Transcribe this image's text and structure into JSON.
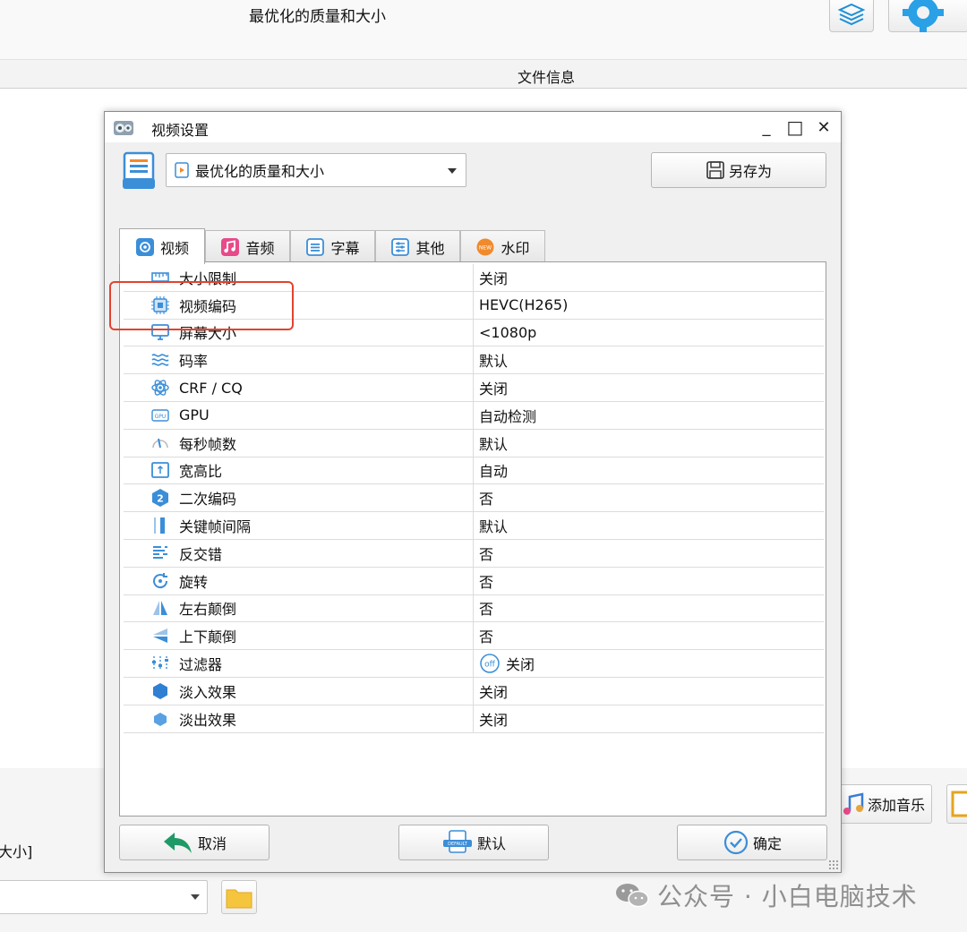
{
  "background": {
    "profile_title": "最优化的质量和大小",
    "file_info_title": "文件信息",
    "add_music_label": "添加音乐",
    "left_label": "大小]",
    "watermark": "公众号 · 小白电脑技术"
  },
  "dialog": {
    "title": "视频设置",
    "minimize": "_",
    "maximize": "□",
    "close": "✕",
    "profile_value": "最优化的质量和大小",
    "save_as_label": "另存为",
    "tabs": [
      {
        "label": "视频",
        "icon": "video-tab-icon"
      },
      {
        "label": "音频",
        "icon": "audio-tab-icon"
      },
      {
        "label": "字幕",
        "icon": "subtitle-tab-icon"
      },
      {
        "label": "其他",
        "icon": "other-tab-icon"
      },
      {
        "label": "水印",
        "icon": "watermark-tab-icon"
      }
    ],
    "settings": [
      {
        "name": "大小限制",
        "value": "关闭"
      },
      {
        "name": "视频编码",
        "value": "HEVC(H265)"
      },
      {
        "name": "屏幕大小",
        "value": "<1080p"
      },
      {
        "name": "码率",
        "value": "默认"
      },
      {
        "name": "CRF / CQ",
        "value": "关闭"
      },
      {
        "name": "GPU",
        "value": "自动检测"
      },
      {
        "name": "每秒帧数",
        "value": "默认"
      },
      {
        "name": "宽高比",
        "value": "自动"
      },
      {
        "name": "二次编码",
        "value": "否"
      },
      {
        "name": "关键帧间隔",
        "value": "默认"
      },
      {
        "name": "反交错",
        "value": "否"
      },
      {
        "name": "旋转",
        "value": "否"
      },
      {
        "name": "左右颠倒",
        "value": "否"
      },
      {
        "name": "上下颠倒",
        "value": "否"
      },
      {
        "name": "过滤器",
        "value": "关闭",
        "badge": "off"
      },
      {
        "name": "淡入效果",
        "value": "关闭"
      },
      {
        "name": "淡出效果",
        "value": "关闭"
      }
    ],
    "cancel_label": "取消",
    "default_label": "默认",
    "default_icon_text": "DEFAULT",
    "confirm_label": "确定"
  },
  "colors": {
    "accent_blue": "#2f7fd3",
    "highlight_red": "#e2432f"
  }
}
